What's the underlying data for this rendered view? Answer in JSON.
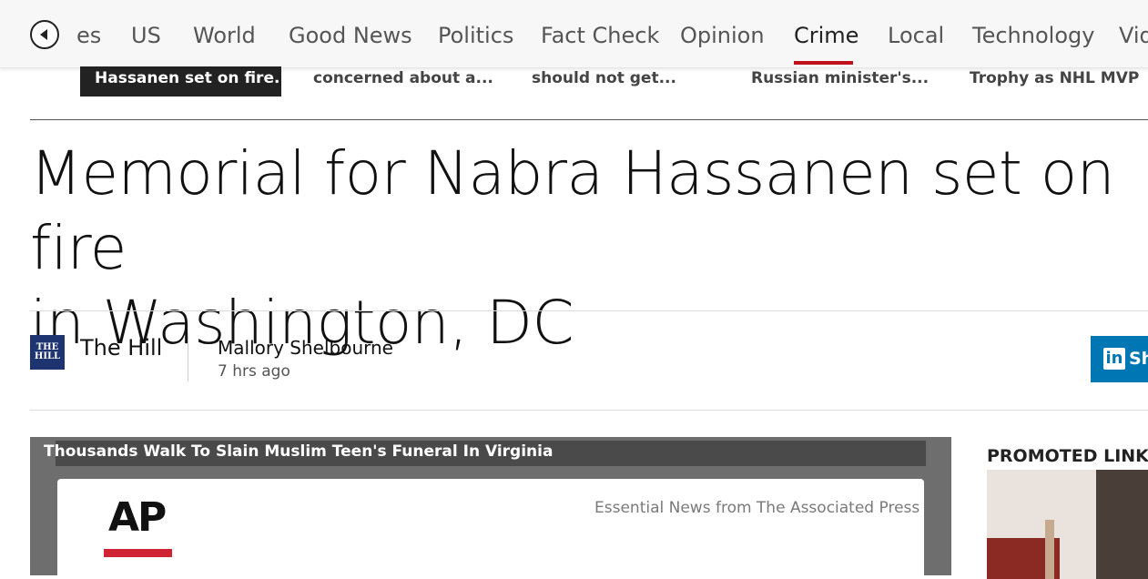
{
  "nav": {
    "items": [
      {
        "label": "es",
        "active": false
      },
      {
        "label": "US",
        "active": false
      },
      {
        "label": "World",
        "active": false
      },
      {
        "label": "Good News",
        "active": false
      },
      {
        "label": "Politics",
        "active": false
      },
      {
        "label": "Fact Check",
        "active": false
      },
      {
        "label": "Opinion",
        "active": false
      },
      {
        "label": "Crime",
        "active": true
      },
      {
        "label": "Local",
        "active": false
      },
      {
        "label": "Technology",
        "active": false
      },
      {
        "label": "Vid",
        "active": false
      }
    ],
    "accent_color": "#c0101a"
  },
  "ticker": {
    "items": [
      "Hassanen set on fire...",
      "concerned about a...",
      "should not get...",
      "Russian minister's...",
      "Trophy as NHL MVP"
    ]
  },
  "article": {
    "headline_line1": "Memorial for Nabra Hassanen set on fire",
    "headline_line2": "in Washington, DC",
    "source_logo_top": "THE",
    "source_logo_bottom": "HILL",
    "source_name": "The Hill",
    "author": "Mallory Shelbourne",
    "time": "7 hrs ago",
    "share_label": "Sh"
  },
  "video": {
    "title": "Thousands Walk To Slain Muslim Teen's Funeral In Virginia",
    "logo_text": "AP",
    "tagline": "Essential News from The Associated Press"
  },
  "sidebar": {
    "promoted_label": "PROMOTED LINKS"
  }
}
